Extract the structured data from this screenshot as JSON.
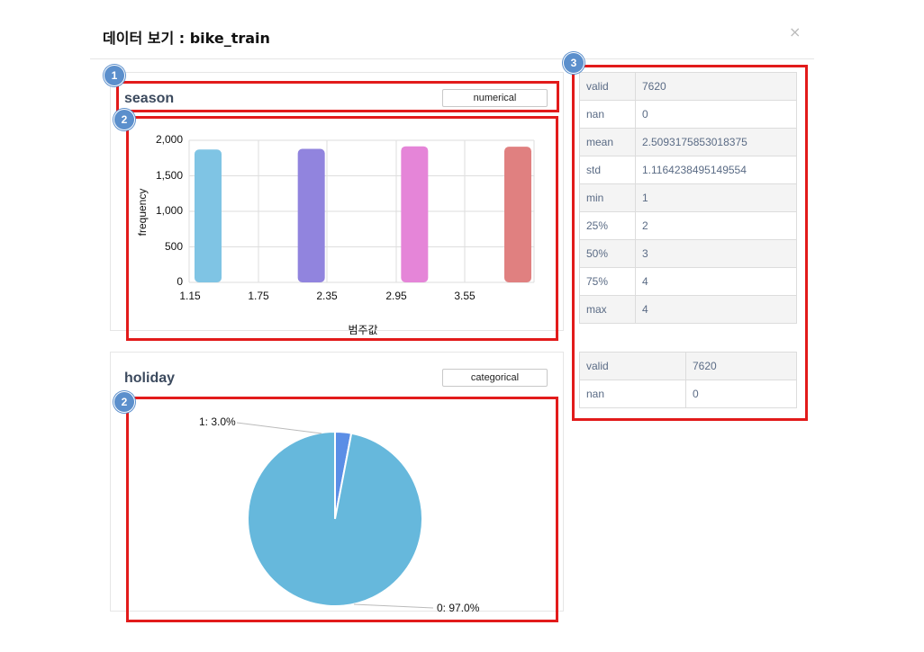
{
  "dialog": {
    "title": "데이터 보기 : bike_train",
    "close_glyph": "×"
  },
  "markers": [
    "1",
    "2",
    "2",
    "3"
  ],
  "columns": [
    {
      "name": "season",
      "type_label": "numerical",
      "chart": {
        "ylabel": "frequency",
        "xlabel": "범주값",
        "yticks": [
          "2,000",
          "1,500",
          "1,000",
          "500",
          "0"
        ],
        "xticks": [
          "1.15",
          "1.75",
          "2.35",
          "2.95",
          "3.55"
        ]
      },
      "stats": [
        {
          "k": "valid",
          "v": "7620"
        },
        {
          "k": "nan",
          "v": "0"
        },
        {
          "k": "mean",
          "v": "2.5093175853018375"
        },
        {
          "k": "std",
          "v": "1.1164238495149554"
        },
        {
          "k": "min",
          "v": "1"
        },
        {
          "k": "25%",
          "v": "2"
        },
        {
          "k": "50%",
          "v": "3"
        },
        {
          "k": "75%",
          "v": "4"
        },
        {
          "k": "max",
          "v": "4"
        }
      ]
    },
    {
      "name": "holiday",
      "type_label": "categorical",
      "chart": {
        "labels": [
          "1: 3.0%",
          "0: 97.0%"
        ]
      },
      "stats": [
        {
          "k": "valid",
          "v": "7620"
        },
        {
          "k": "nan",
          "v": "0"
        }
      ]
    }
  ],
  "chart_data": [
    {
      "type": "bar",
      "x": [
        1,
        2,
        3,
        4
      ],
      "values": [
        1870,
        1880,
        1915,
        1910
      ],
      "colors": [
        "#7fc4e4",
        "#9184de",
        "#e585d8",
        "#e08080"
      ],
      "xlabel": "범주값",
      "ylabel": "frequency",
      "ylim": [
        0,
        2000
      ],
      "xticks": [
        1.15,
        1.75,
        2.35,
        2.95,
        3.55
      ],
      "grid": true
    },
    {
      "type": "pie",
      "categories": [
        "1",
        "0"
      ],
      "values": [
        3.0,
        97.0
      ],
      "labels": [
        "1: 3.0%",
        "0: 97.0%"
      ],
      "colors": [
        "#5b8ee6",
        "#66b8dc"
      ]
    }
  ]
}
